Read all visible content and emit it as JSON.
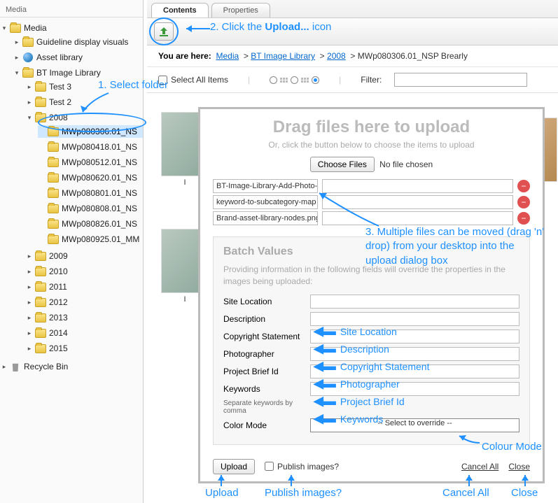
{
  "sidebar": {
    "title": "Media",
    "root": "Media",
    "items": [
      {
        "label": "Guideline display visuals"
      },
      {
        "label": "Asset library"
      },
      {
        "label": "BT Image Library"
      }
    ],
    "bt_children": [
      {
        "label": "Test 3"
      },
      {
        "label": "Test 2"
      },
      {
        "label": "2008"
      }
    ],
    "year_children": [
      {
        "label": "MWp080306.01_NS"
      },
      {
        "label": "MWp080418.01_NS"
      },
      {
        "label": "MWp080512.01_NS"
      },
      {
        "label": "MWp080620.01_NS"
      },
      {
        "label": "MWp080801.01_NS"
      },
      {
        "label": "MWp080808.01_NS"
      },
      {
        "label": "MWp080826.01_NS"
      },
      {
        "label": "MWp080925.01_MM"
      }
    ],
    "years_rest": [
      {
        "label": "2009"
      },
      {
        "label": "2010"
      },
      {
        "label": "2011"
      },
      {
        "label": "2012"
      },
      {
        "label": "2013"
      },
      {
        "label": "2014"
      },
      {
        "label": "2015"
      }
    ],
    "recycle": "Recycle Bin"
  },
  "tabs": {
    "contents": "Contents",
    "properties": "Properties"
  },
  "breadcrumb": {
    "label": "You are here:",
    "parts": [
      "Media",
      "BT Image Library",
      "2008"
    ],
    "current": "MWp080306.01_NSP Brearly"
  },
  "filterbar": {
    "select_all": "Select All Items",
    "filter_label": "Filter:"
  },
  "dialog": {
    "title": "Drag files here to upload",
    "subtitle": "Or, click the button below to choose the items to upload",
    "choose": "Choose Files",
    "no_file": "No file chosen",
    "files": [
      "BT-Image-Library-Add-Photo-",
      "keyword-to-subcategory-map",
      "Brand-asset-library-nodes.png"
    ],
    "batch_title": "Batch Values",
    "batch_desc": "Providing information in the following fields will override the properties in the images being uploaded:",
    "fields": {
      "site": "Site Location",
      "desc": "Description",
      "copy": "Copyright Statement",
      "photog": "Photographer",
      "brief": "Project Brief Id",
      "keywords": "Keywords",
      "kw_note": "Separate keywords by comma",
      "color": "Color Mode",
      "color_sel": "-- Select to override --"
    },
    "footer": {
      "upload": "Upload",
      "publish": "Publish images?",
      "cancel": "Cancel All",
      "close": "Close"
    }
  },
  "annotations": {
    "a1": "1. Select folder",
    "a2_pre": "2. Click the ",
    "a2_b": "Upload...",
    "a2_post": " icon",
    "a3": "3. Multiple files can be moved (drag 'n' drop) from your desktop into the upload dialog box",
    "c_site": "Site Location",
    "c_desc": "Description",
    "c_copy": "Copyright Statement",
    "c_photog": "Photographer",
    "c_brief": "Project Brief Id",
    "c_kw": "Keywords",
    "c_color": "Colour Mode",
    "b_upload": "Upload",
    "b_publish": "Publish images?",
    "b_cancel": "Cancel All",
    "b_close": "Close"
  },
  "thumb_label": "I"
}
